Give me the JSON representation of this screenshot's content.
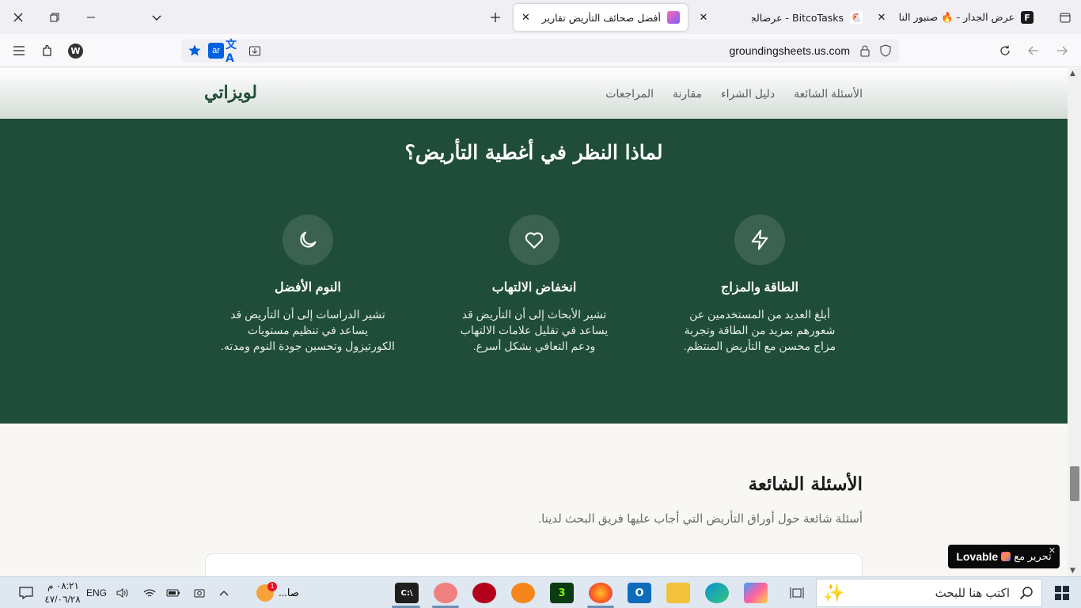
{
  "browser": {
    "tabs": [
      {
        "title": "عرض الجدار - 🔥 صنبور النار 🔥",
        "active": false
      },
      {
        "title": "BitcoTasks - عرضالجدار",
        "active": false
      },
      {
        "title": "أفضل صحائف التأريض تقارير المت",
        "active": true
      }
    ],
    "url": "groundingsheets.us.com",
    "lang_badge": "ar",
    "w_badge": "W"
  },
  "site": {
    "logo": "لويزاتي",
    "nav": [
      "الأسئلة الشائعة",
      "دليل الشراء",
      "مقارنة",
      "المراجعات"
    ],
    "why_title": "لماذا النظر في أغطية التأريض؟",
    "features": [
      {
        "icon": "lightning-icon",
        "title": "الطاقة والمزاج",
        "lines": [
          "أبلغ العديد من المستخدمين عن",
          "شعورهم بمزيد من الطاقة وتجربة",
          "مزاج محسن مع التأريض المنتظم."
        ]
      },
      {
        "icon": "heart-icon",
        "title": "انخفاض الالتهاب",
        "lines": [
          "تشير الأبحاث إلى أن التأريض قد",
          "يساعد في تقليل علامات الالتهاب",
          "ودعم التعافي بشكل أسرع."
        ]
      },
      {
        "icon": "moon-icon",
        "title": "النوم الأفضل",
        "lines": [
          "تشير الدراسات إلى أن التأريض قد",
          "يساعد في تنظيم مستويات",
          "الكورتيزول وتحسين جودة النوم ومدته."
        ]
      }
    ],
    "faq_title": "الأسئلة الشائعة",
    "faq_subtitle": "أسئلة شائعة حول أوراق التأريض التي أجاب عليها فريق البحث لدينا.",
    "lovable_brand": "Lovable",
    "lovable_label": "تحرير مع"
  },
  "taskbar": {
    "search_placeholder": "اكتب هنا للبحث",
    "time": "٠٨:٢١ م",
    "date": "٤٧/٠٦/٢٨",
    "lang": "ENG",
    "app_label": "صا...",
    "badge_count": "1"
  },
  "colors": {
    "green": "#1f4d3a",
    "circle": "#3b6150"
  }
}
